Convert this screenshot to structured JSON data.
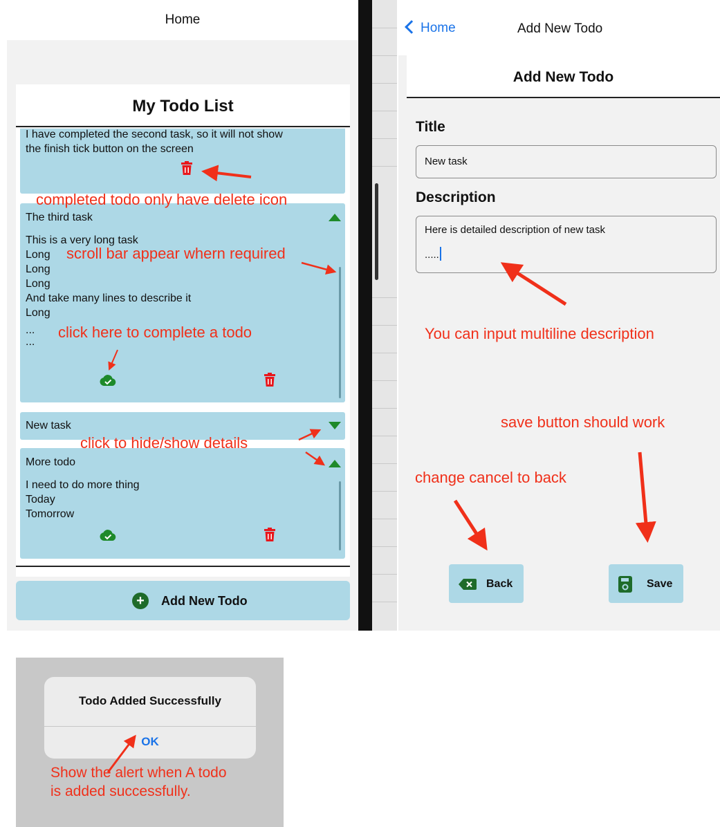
{
  "left_screen": {
    "nav_title": "Home",
    "list_title": "My Todo List",
    "todos": [
      {
        "title": "",
        "description_lines": [
          "I have completed the second task, so it will not show",
          "the finish tick button on the screen"
        ],
        "completed": true
      },
      {
        "title": "The third task",
        "description_lines": [
          "This is a very long task",
          "Long",
          "Long",
          "Long",
          "And take many lines to describe it",
          "Long",
          "...",
          "..."
        ],
        "expanded": true,
        "completed": false
      },
      {
        "title": "New task",
        "expanded": false,
        "completed": false
      },
      {
        "title": "More todo",
        "description_lines": [
          "I need to do more thing",
          "Today",
          "Tomorrow"
        ],
        "expanded": true,
        "completed": false
      }
    ],
    "add_button_label": "Add New Todo"
  },
  "right_screen": {
    "back_label": "Home",
    "nav_title": "Add New Todo",
    "form_title": "Add New Todo",
    "title_label": "Title",
    "title_value": "New task",
    "description_label": "Description",
    "description_lines": [
      "Here is detailed description of new task",
      "....."
    ],
    "back_button_label": "Back",
    "save_button_label": "Save"
  },
  "alert": {
    "title": "Todo Added Successfully",
    "ok_label": "OK"
  },
  "annotations": {
    "completed_delete": "completed todo only have delete icon",
    "scroll_bar": "scroll bar appear whern required",
    "complete_todo": "click here to complete a todo",
    "hide_show": "click to hide/show details",
    "multiline": "You can input multiline description",
    "save_work": "save button should work",
    "cancel_back": "change cancel to back",
    "alert_line1": "Show the alert when A todo",
    "alert_line2": "is added successfully."
  },
  "colors": {
    "card_blue": "#add8e6",
    "icon_green": "#1e8a2a",
    "delete_red": "#e8161b",
    "annotation_red": "#f0301a",
    "link_blue": "#1a73e8"
  },
  "icons": [
    "trash-icon",
    "cloud-check-icon",
    "triangle-up-icon",
    "triangle-down-icon",
    "plus-circle-icon",
    "backspace-icon",
    "save-icon",
    "chevron-left-icon"
  ]
}
